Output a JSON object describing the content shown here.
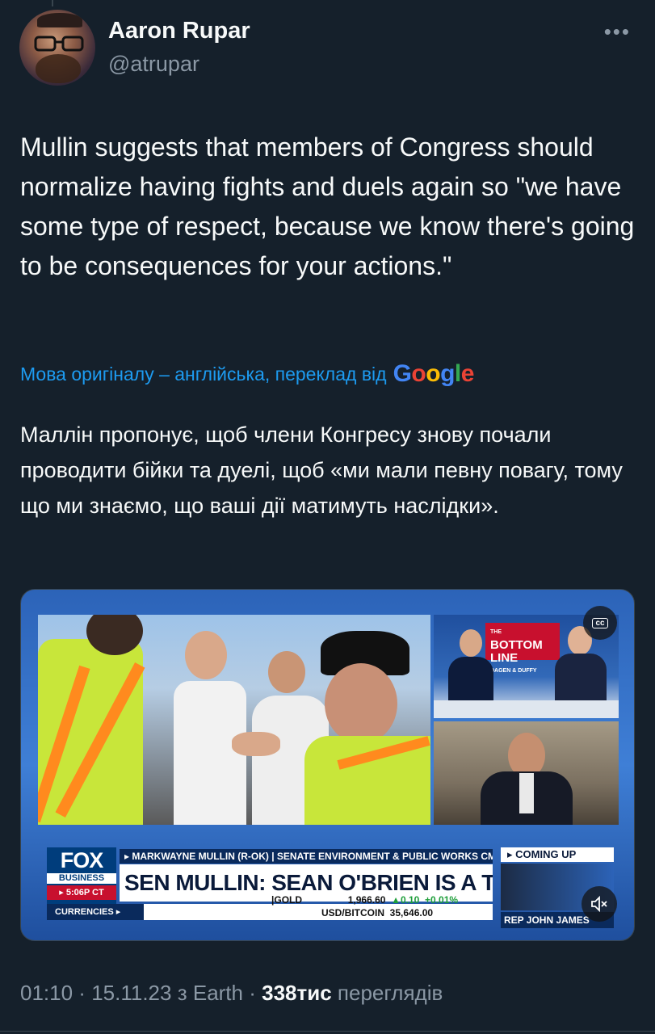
{
  "colors": {
    "background": "#15202b",
    "text": "#f7f9f9",
    "muted": "#8b98a5",
    "link": "#1d9bf0"
  },
  "author": {
    "name": "Aaron Rupar",
    "handle": "@atrupar",
    "avatar_icon": "avatar-photo"
  },
  "more_icon": "more-horizontal-icon",
  "tweet": {
    "text": "Mullin suggests that members of Congress should normalize having fights and duels again so \"we have some type of respect, because we know there's going to be consequences for your actions.\""
  },
  "translation": {
    "note": "Мова оригіналу – англійська, переклад від",
    "provider": "Google",
    "text": "Маллін пропонує, щоб члени Конгресу знову почали проводити бійки та дуелі, щоб «ми мали певну повагу, тому що ми знаємо, що ваші дії матимуть наслідки»."
  },
  "media": {
    "cc_label": "cc",
    "mute_icon": "volume-muted-icon",
    "network": {
      "line1": "FOX",
      "line2": "BUSINESS",
      "time": "▸ 5:06P CT"
    },
    "chyron_sub": "▸ MARKWAYNE MULLIN (R-OK) | SENATE ENVIRONMENT & PUBLIC WORKS CMTE",
    "headline": "SEN MULLIN: SEAN O'BRIEN IS A THUG",
    "ticker": {
      "currencies": "CURRENCIES ▸",
      "gold_label": "|GOLD",
      "gold_value": "1,966.60",
      "gold_change": "▲0.10",
      "gold_pct": "+0.01%",
      "btc_label": "USD/BITCOIN",
      "btc_value": "35,646.00"
    },
    "show_logo": {
      "line1": "THE",
      "line2": "BOTTOM",
      "line3": "LINE",
      "sub": "DAGEN & DUFFY"
    },
    "coming_up": "▸ COMING UP",
    "coming_up_guest": "REP JOHN JAMES"
  },
  "meta": {
    "time": "01:10",
    "date": "15.11.23",
    "via": "з Earth",
    "views_count": "338тис",
    "views_label": "переглядів"
  }
}
